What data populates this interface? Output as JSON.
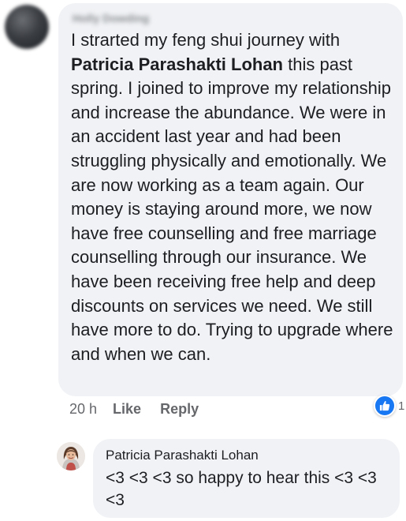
{
  "comment": {
    "author": "Holly Dowding",
    "text_before": "I strarted my feng shui journey with ",
    "mention": "Patricia Parashakti Lohan",
    "text_after": " this past spring. I joined to improve my relationship and increase the abundance. We were in an accident last year and had been struggling physically and emotionally.  We are now working as a team again. Our money is staying around more, we now have free counselling and free marriage counselling through our insurance.  We have been receiving free help and deep discounts on services we need.  We still have more to do.  Trying to upgrade where and when we can.",
    "time": "20 h",
    "like_label": "Like",
    "reply_label": "Reply",
    "reaction_count": "1",
    "reaction_icon": "thumbs-up-icon",
    "reaction_color": "#1877f2"
  },
  "reply": {
    "author": "Patricia Parashakti Lohan",
    "text": "<3 <3 <3 so happy to hear this <3 <3 <3"
  },
  "colors": {
    "bubble_bg": "#f0f2f5",
    "text": "#1c1e21",
    "secondary_text": "#65676b"
  }
}
